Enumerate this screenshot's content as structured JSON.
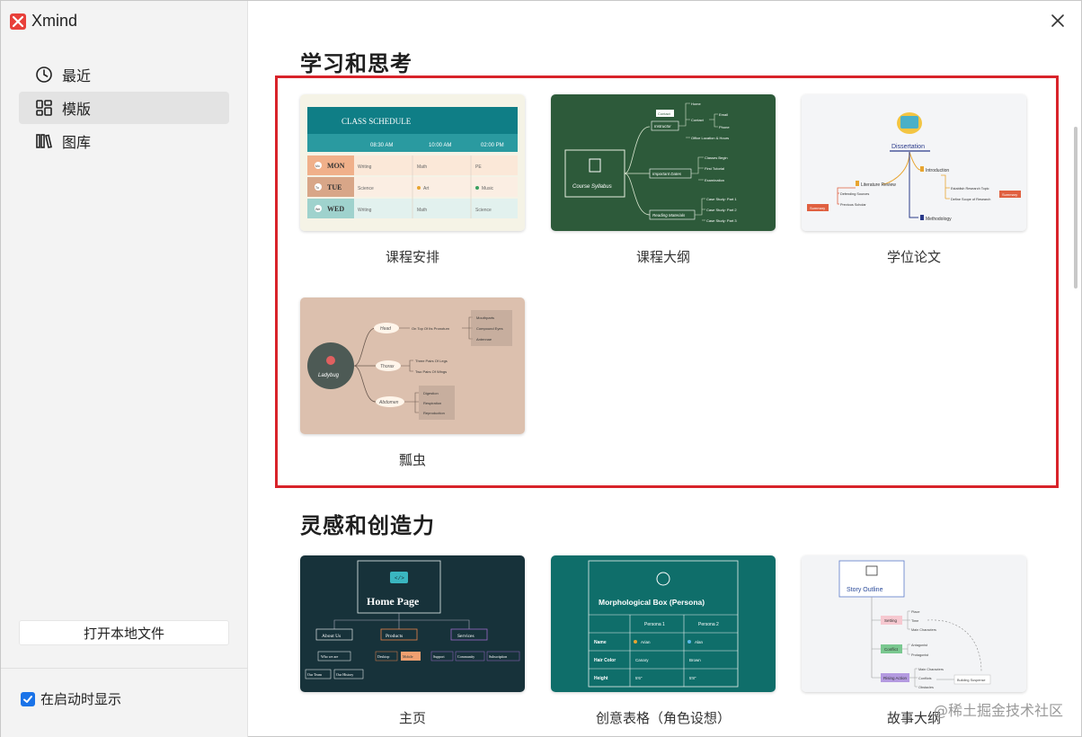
{
  "app": {
    "name": "Xmind",
    "brand_color": "#e8403a"
  },
  "sidebar": {
    "items": [
      {
        "label": "最近",
        "icon": "clock-icon",
        "active": false
      },
      {
        "label": "模版",
        "icon": "template-grid-icon",
        "active": true
      },
      {
        "label": "图库",
        "icon": "library-books-icon",
        "active": false
      }
    ],
    "open_local_label": "打开本地文件",
    "show_on_startup_label": "在启动时显示",
    "show_on_startup_checked": true
  },
  "sections": [
    {
      "title": "学习和思考",
      "templates": [
        {
          "label": "课程安排",
          "thumb": {
            "title": "CLASS SCHEDULE",
            "times": [
              "08:30 AM",
              "10:00 AM",
              "02:00 PM"
            ],
            "rows": [
              {
                "tag": "Mo",
                "day": "MON",
                "cells": [
                  "Writing",
                  "Math",
                  "PE"
                ]
              },
              {
                "tag": "Tu",
                "day": "TUE",
                "cells": [
                  "Science",
                  "Art",
                  "Music"
                ]
              },
              {
                "tag": "We",
                "day": "WED",
                "cells": [
                  "Writing",
                  "Math",
                  "Science"
                ]
              }
            ]
          }
        },
        {
          "label": "课程大纲",
          "thumb": {
            "center": "Course Syllabus",
            "branches": [
              "Instructor",
              "Important Dates",
              "Reading Materials"
            ],
            "sub_instructor": [
              "Home",
              "Contact",
              "Office Location & Hours"
            ],
            "sub_contact": [
              "Email",
              "Phone"
            ],
            "contact_callout": "Contact",
            "sub_dates": [
              "Classes Begin",
              "First Tutorial",
              "Examination"
            ],
            "sub_reading": [
              "Case Study: Part 1",
              "Case Study: Part 2",
              "Case Study: Part 3"
            ]
          }
        },
        {
          "label": "学位论文",
          "thumb": {
            "center": "Dissertation",
            "left": [
              "Literature Review"
            ],
            "left_sub": [
              "Defending Sources",
              "Previous Scholar"
            ],
            "left_summary": "Summary",
            "right": [
              "Introduction",
              "Methodology"
            ],
            "right_sub": [
              "Establish Research Topic",
              "Define Scope of Research"
            ],
            "right_summary": "Summary"
          }
        },
        {
          "label": "瓢虫",
          "thumb": {
            "center": "Ladybug",
            "branches": [
              "Head",
              "Thorax",
              "Abdomen"
            ],
            "head_note": "On Top Of Its Pronotum",
            "head_sub": [
              "Mouthparts",
              "Compound Eyes",
              "Antennae"
            ],
            "thorax_sub": [
              "Three Pairs Of Legs",
              "Two Pairs Of Wings"
            ],
            "abdomen_sub": [
              "Digestion",
              "Respiration",
              "Reproduction"
            ]
          }
        }
      ]
    },
    {
      "title": "灵感和创造力",
      "templates": [
        {
          "label": "主页",
          "thumb": {
            "center": "Home Page",
            "branches": [
              "About Us",
              "Products",
              "Services"
            ],
            "about_sub": [
              "Who we are",
              "Our Team",
              "Our History"
            ],
            "products_sub": [
              "Desktop",
              "Mobile"
            ],
            "services_sub": [
              "Support",
              "Community",
              "Subscription"
            ]
          }
        },
        {
          "label": "创意表格（角色设想）",
          "thumb": {
            "title": "Morphological Box (Persona)",
            "columns": [
              "Persona 1",
              "Persona 2"
            ],
            "rows": [
              {
                "head": "Name",
                "cells": [
                  "Arian",
                  "Alan"
                ]
              },
              {
                "head": "Hair Color",
                "cells": [
                  "Canary",
                  "Brown"
                ]
              },
              {
                "head": "Height",
                "cells": [
                  "5'6\"",
                  "5'8\""
                ]
              }
            ]
          }
        },
        {
          "label": "故事大纲",
          "thumb": {
            "center": "Story Outline",
            "branches": [
              "Setting",
              "Conflict",
              "Rising Action"
            ],
            "setting_sub": [
              "Place",
              "Time",
              "Main Characters"
            ],
            "conflict_sub": [
              "Antagonist",
              "Protagonist"
            ],
            "rising_sub": [
              "Main Characters",
              "Conflicts",
              "Obstacles"
            ],
            "rising_note": "Building Suspense"
          }
        }
      ]
    }
  ],
  "credit": "@稀土掘金技术社区"
}
